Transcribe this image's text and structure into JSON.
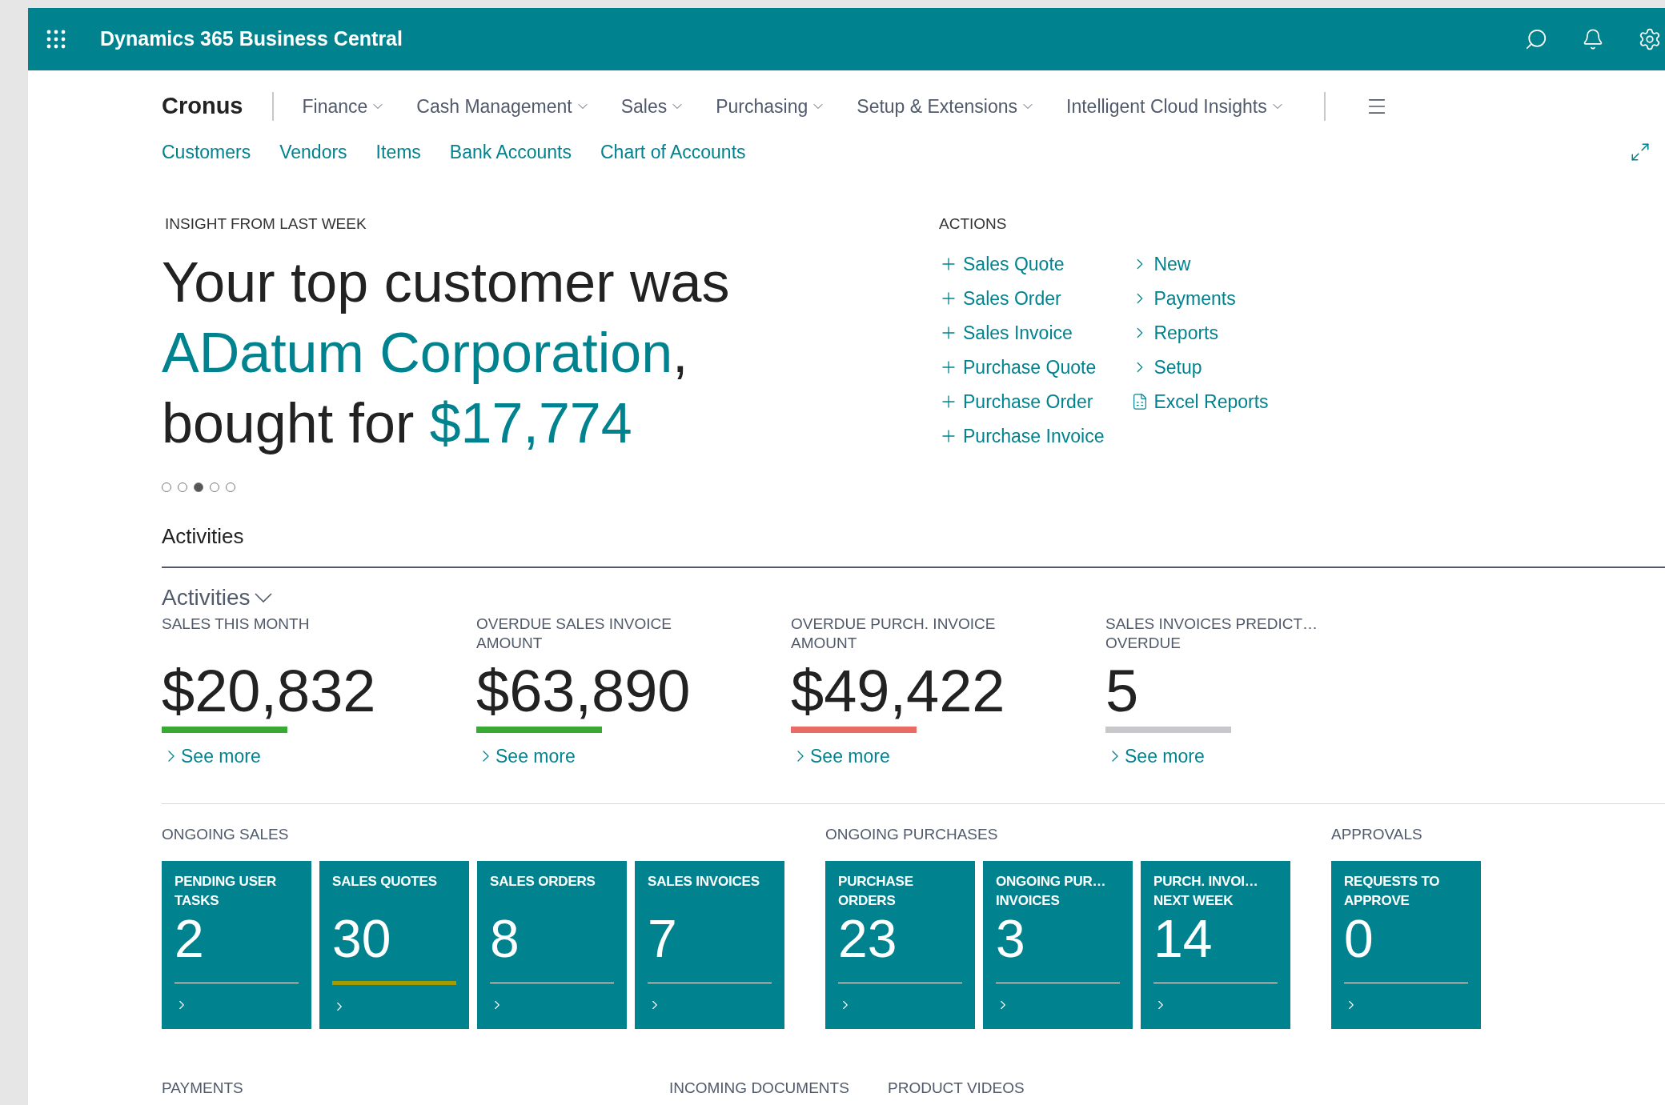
{
  "app_bar": {
    "title": "Dynamics 365 Business Central"
  },
  "navigation": {
    "company": "Cronus",
    "menus": [
      {
        "label": "Finance"
      },
      {
        "label": "Cash Management"
      },
      {
        "label": "Sales"
      },
      {
        "label": "Purchasing"
      },
      {
        "label": "Setup & Extensions"
      },
      {
        "label": "Intelligent Cloud Insights"
      }
    ],
    "links": [
      "Customers",
      "Vendors",
      "Items",
      "Bank Accounts",
      "Chart of Accounts"
    ]
  },
  "insight": {
    "label": "INSIGHT FROM LAST WEEK",
    "lines": [
      [
        {
          "text": "Your top customer was",
          "highlight": false
        }
      ],
      [
        {
          "text": "ADatum Corporation",
          "highlight": true
        },
        {
          "text": ",",
          "highlight": false
        }
      ],
      [
        {
          "text": "bought for ",
          "highlight": false
        },
        {
          "text": "$17,774",
          "highlight": true
        }
      ]
    ],
    "pages": [
      {
        "selected": false
      },
      {
        "selected": false
      },
      {
        "selected": true
      },
      {
        "selected": false
      },
      {
        "selected": false
      }
    ]
  },
  "actions": {
    "label": "ACTIONS",
    "columns": [
      [
        {
          "kind": "create",
          "label": "Sales Quote"
        },
        {
          "kind": "create",
          "label": "Sales Order"
        },
        {
          "kind": "create",
          "label": "Sales Invoice"
        },
        {
          "kind": "create",
          "label": "Purchase Quote"
        },
        {
          "kind": "create",
          "label": "Purchase Order"
        },
        {
          "kind": "create",
          "label": "Purchase Invoice"
        }
      ],
      [
        {
          "kind": "group",
          "label": "New"
        },
        {
          "kind": "group",
          "label": "Payments"
        },
        {
          "kind": "group",
          "label": "Reports"
        },
        {
          "kind": "group",
          "label": "Setup"
        },
        {
          "kind": "report",
          "label": "Excel Reports"
        }
      ]
    ]
  },
  "activities": {
    "heading": "Activities",
    "group": "Activities",
    "cues": [
      {
        "label": "SALES THIS MONTH",
        "value": "$20,832",
        "color": "#3aaa35",
        "link": "See more"
      },
      {
        "label": "OVERDUE SALES INVOICE AMOUNT",
        "value": "$63,890",
        "color": "#3aaa35",
        "link": "See more"
      },
      {
        "label": "OVERDUE PURCH. INVOICE AMOUNT",
        "value": "$49,422",
        "color": "#ea6b66",
        "link": "See more"
      },
      {
        "label": "SALES INVOICES PREDICT… OVERDUE",
        "value": "5",
        "color": "#c8c8cc",
        "link": "See more"
      }
    ]
  },
  "tile_groups": [
    {
      "label": "ONGOING SALES",
      "tiles": [
        {
          "label": "PENDING USER TASKS",
          "value": "2"
        },
        {
          "label": "SALES QUOTES",
          "value": "30",
          "color": "#a39b00"
        },
        {
          "label": "SALES ORDERS",
          "value": "8"
        },
        {
          "label": "SALES INVOICES",
          "value": "7"
        }
      ]
    },
    {
      "label": "ONGOING PURCHASES",
      "tiles": [
        {
          "label": "PURCHASE ORDERS",
          "value": "23"
        },
        {
          "label": "ONGOING PUR… INVOICES",
          "value": "3"
        },
        {
          "label": "PURCH. INVOI… NEXT WEEK",
          "value": "14"
        }
      ]
    },
    {
      "label": "APPROVALS",
      "tiles": [
        {
          "label": "REQUESTS TO APPROVE",
          "value": "0"
        }
      ]
    }
  ],
  "bottom_sections": [
    "PAYMENTS",
    "INCOMING DOCUMENTS",
    "PRODUCT VIDEOS"
  ]
}
